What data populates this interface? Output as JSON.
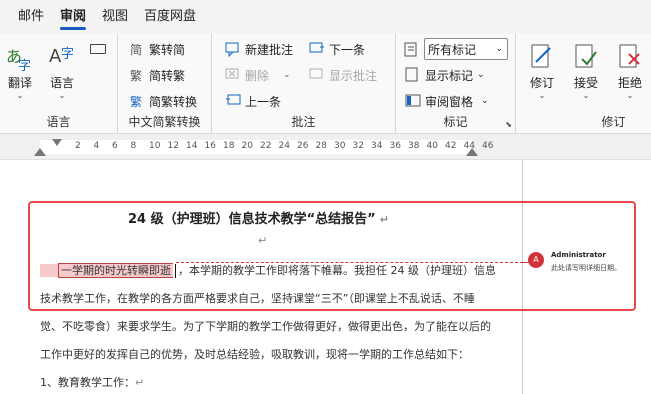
{
  "tabs": [
    {
      "label": "邮件",
      "active": false
    },
    {
      "label": "审阅",
      "active": true
    },
    {
      "label": "视图",
      "active": false
    },
    {
      "label": "百度网盘",
      "active": false
    }
  ],
  "ribbon": {
    "language": {
      "translate": "翻译",
      "language": "语言",
      "group_label": "语言"
    },
    "chinese": {
      "trad": "繁转简",
      "simp": "简转繁",
      "convert": "简繁转换",
      "group_label": "中文简繁转换"
    },
    "comments": {
      "new": "新建批注",
      "delete": "删除",
      "prev": "上一条",
      "next": "下一条",
      "show": "显示批注",
      "group_label": "批注"
    },
    "markup": {
      "select_value": "所有标记",
      "show_markup": "显示标记",
      "pane": "审阅窗格",
      "group_label": "标记"
    },
    "tracking": {
      "revise": "修订",
      "accept": "接受",
      "reject": "拒绝",
      "group_label": "修订"
    }
  },
  "ruler": {
    "ticks": [
      "2",
      "4",
      "6",
      "8",
      "10",
      "12",
      "14",
      "16",
      "18",
      "20",
      "22",
      "24",
      "26",
      "28",
      "30",
      "32",
      "34",
      "36",
      "38",
      "40",
      "42",
      "44",
      "46"
    ]
  },
  "document": {
    "title": "24 级（护理班）信息技术教学“总结报告”",
    "highlighted": "一学期的时光转瞬即逝",
    "line1_rest": "，本学期的教学工作即将落下帷幕。我担任 24 级（护理班）信息",
    "line2": "技术教学工作，在教学的各方面严格要求自己，坚持课堂“三不”（即课堂上不乱说话、不睡",
    "line3": "觉、不吃零食）来要求学生。为了下学期的教学工作做得更好，做得更出色，为了能在以后的",
    "line4": "工作中更好的发挥自己的优势，及时总结经验，吸取教训，现将一学期的工作总结如下：",
    "line5": "1、教育教学工作：",
    "para_mark": "↵"
  },
  "comment": {
    "avatar": "A",
    "author": "Administrator",
    "body": "此处请写明详细日期。"
  },
  "colors": {
    "accent": "#185abd",
    "highlight": "#e8474c"
  }
}
